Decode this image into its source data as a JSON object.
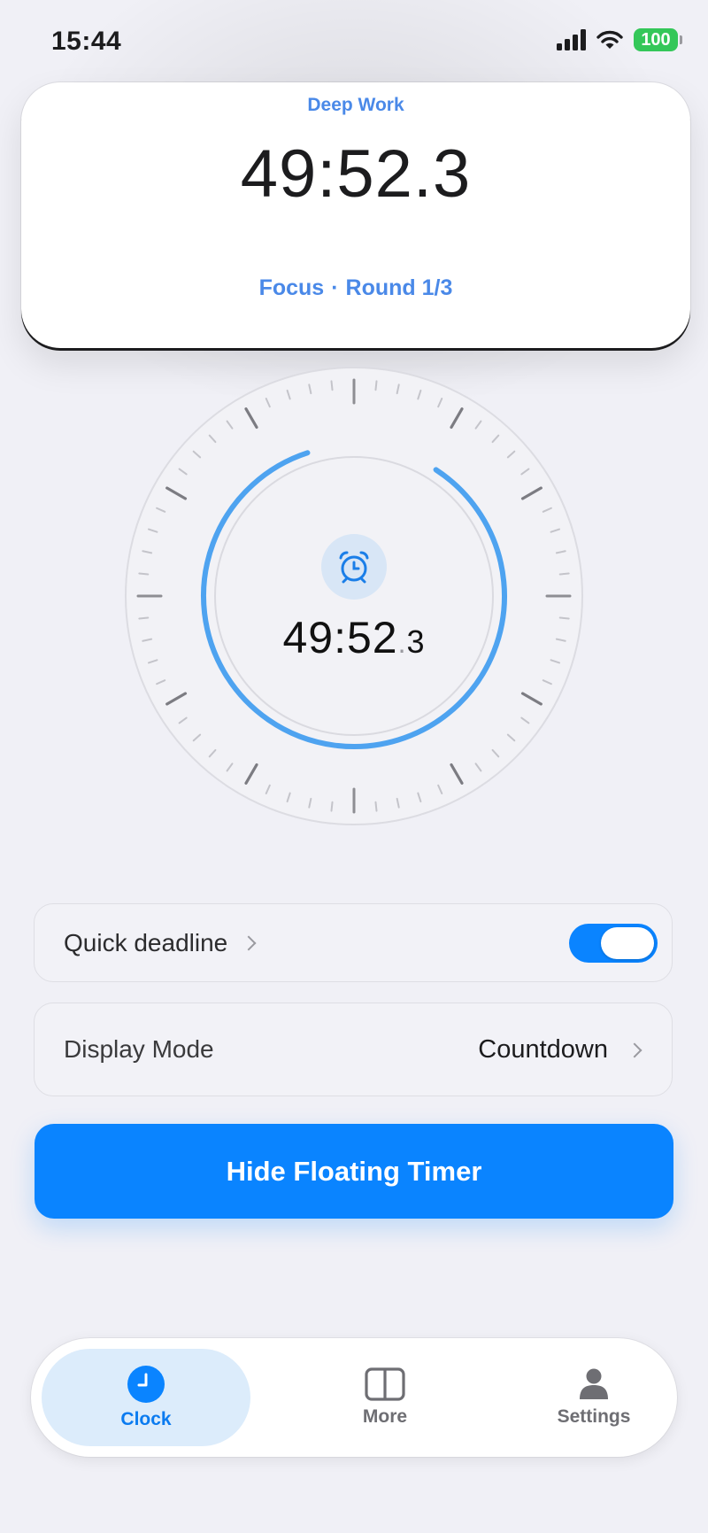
{
  "status_bar": {
    "time": "15:44",
    "battery": "100"
  },
  "floating_timer": {
    "label": "Deep Work",
    "time": "49:52.3",
    "phase": "Focus",
    "separator": "·",
    "round": "Round 1/3"
  },
  "dial": {
    "time_main": "49:52",
    "time_dot": ".",
    "time_tenths": "3",
    "icon": "alarm-clock-icon",
    "progress_ring": "gapped near top"
  },
  "settings": {
    "quick_deadline": {
      "label": "Quick deadline",
      "enabled": true
    },
    "display_mode": {
      "label": "Display Mode",
      "value": "Countdown"
    }
  },
  "main_button": {
    "label": "Hide Floating Timer"
  },
  "tabs": [
    {
      "label": "Clock",
      "icon": "clock-icon",
      "active": true
    },
    {
      "label": "More",
      "icon": "split-view-icon",
      "active": false
    },
    {
      "label": "Settings",
      "icon": "person-icon",
      "active": false
    }
  ],
  "colors": {
    "accent": "#0a84ff",
    "label_blue": "#4a89e8",
    "battery": "#34c759",
    "ring": "#4ea3f0"
  }
}
